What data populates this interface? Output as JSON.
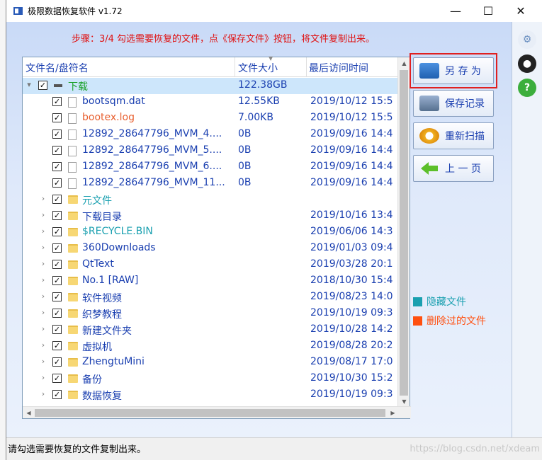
{
  "window": {
    "title": "极限数据恢复软件 v1.72"
  },
  "step_text": "步骤：3/4 勾选需要恢复的文件，点《保存文件》按钮，将文件复制出来。",
  "columns": {
    "name": "文件名/盘符名",
    "size": "文件大小",
    "date": "最后访问时间"
  },
  "rows": [
    {
      "name": "下载",
      "size": "122.38GB",
      "date": "",
      "kind": "drive",
      "expanded": true,
      "level": 0,
      "checked": true,
      "color": "#1aa028"
    },
    {
      "name": "bootsqm.dat",
      "size": "12.55KB",
      "date": "2019/10/12 15:5",
      "kind": "file",
      "level": 1,
      "checked": true,
      "color": "#1a3fb0"
    },
    {
      "name": "bootex.log",
      "size": "7.00KB",
      "date": "2019/10/12 15:5",
      "kind": "file",
      "level": 1,
      "checked": true,
      "color": "#e86030"
    },
    {
      "name": "12892_28647796_MVM_4....",
      "size": "0B",
      "date": "2019/09/16 14:4",
      "kind": "file",
      "level": 1,
      "checked": true,
      "color": "#1a3fb0"
    },
    {
      "name": "12892_28647796_MVM_5....",
      "size": "0B",
      "date": "2019/09/16 14:4",
      "kind": "file",
      "level": 1,
      "checked": true,
      "color": "#1a3fb0"
    },
    {
      "name": "12892_28647796_MVM_6....",
      "size": "0B",
      "date": "2019/09/16 14:4",
      "kind": "file",
      "level": 1,
      "checked": true,
      "color": "#1a3fb0"
    },
    {
      "name": "12892_28647796_MVM_11...",
      "size": "0B",
      "date": "2019/09/16 14:4",
      "kind": "file",
      "level": 1,
      "checked": true,
      "color": "#1a3fb0"
    },
    {
      "name": "元文件",
      "size": "",
      "date": "",
      "kind": "folder",
      "level": 1,
      "checked": true,
      "color": "#1aa0b0"
    },
    {
      "name": "下载目录",
      "size": "",
      "date": "2019/10/16 13:4",
      "kind": "folder",
      "level": 1,
      "checked": true,
      "color": "#1a3fb0"
    },
    {
      "name": "$RECYCLE.BIN",
      "size": "",
      "date": "2019/06/06 14:3",
      "kind": "folder",
      "level": 1,
      "checked": true,
      "color": "#1aa0b0"
    },
    {
      "name": "360Downloads",
      "size": "",
      "date": "2019/01/03 09:4",
      "kind": "folder",
      "level": 1,
      "checked": true,
      "color": "#1a3fb0"
    },
    {
      "name": "QtText",
      "size": "",
      "date": "2019/03/28 20:1",
      "kind": "folder",
      "level": 1,
      "checked": true,
      "color": "#1a3fb0"
    },
    {
      "name": "No.1 [RAW]",
      "size": "",
      "date": "2018/10/30 15:4",
      "kind": "folder",
      "level": 1,
      "checked": true,
      "color": "#1a3fb0"
    },
    {
      "name": "软件视频",
      "size": "",
      "date": "2019/08/23 14:0",
      "kind": "folder",
      "level": 1,
      "checked": true,
      "color": "#1a3fb0"
    },
    {
      "name": "织梦教程",
      "size": "",
      "date": "2019/10/19 09:3",
      "kind": "folder",
      "level": 1,
      "checked": true,
      "color": "#1a3fb0"
    },
    {
      "name": "新建文件夹",
      "size": "",
      "date": "2019/10/28 14:2",
      "kind": "folder",
      "level": 1,
      "checked": true,
      "color": "#1a3fb0"
    },
    {
      "name": "虚拟机",
      "size": "",
      "date": "2019/08/28 20:2",
      "kind": "folder",
      "level": 1,
      "checked": true,
      "color": "#1a3fb0"
    },
    {
      "name": "ZhengtuMini",
      "size": "",
      "date": "2019/08/17 17:0",
      "kind": "folder",
      "level": 1,
      "checked": true,
      "color": "#1a3fb0"
    },
    {
      "name": "备份",
      "size": "",
      "date": "2019/10/30 15:2",
      "kind": "folder",
      "level": 1,
      "checked": true,
      "color": "#1a3fb0"
    },
    {
      "name": "数据恢复",
      "size": "",
      "date": "2019/10/19 09:3",
      "kind": "folder",
      "level": 1,
      "checked": true,
      "color": "#1a3fb0"
    }
  ],
  "buttons": {
    "save_as": "另 存 为",
    "save_log": "保存记录",
    "rescan": "重新扫描",
    "prev": "上 一 页"
  },
  "legend": {
    "hidden": {
      "label": "隐藏文件",
      "color": "#1aa0b0"
    },
    "deleted": {
      "label": "删除过的文件",
      "color": "#ff5010"
    }
  },
  "status": {
    "text": "请勾选需要恢复的文件复制出来。",
    "watermark": "https://blog.csdn.net/xdeam"
  },
  "colors": {
    "accent_red": "#e01010",
    "text_blue": "#1a3fb0",
    "selected_row": "#cde6fb"
  }
}
